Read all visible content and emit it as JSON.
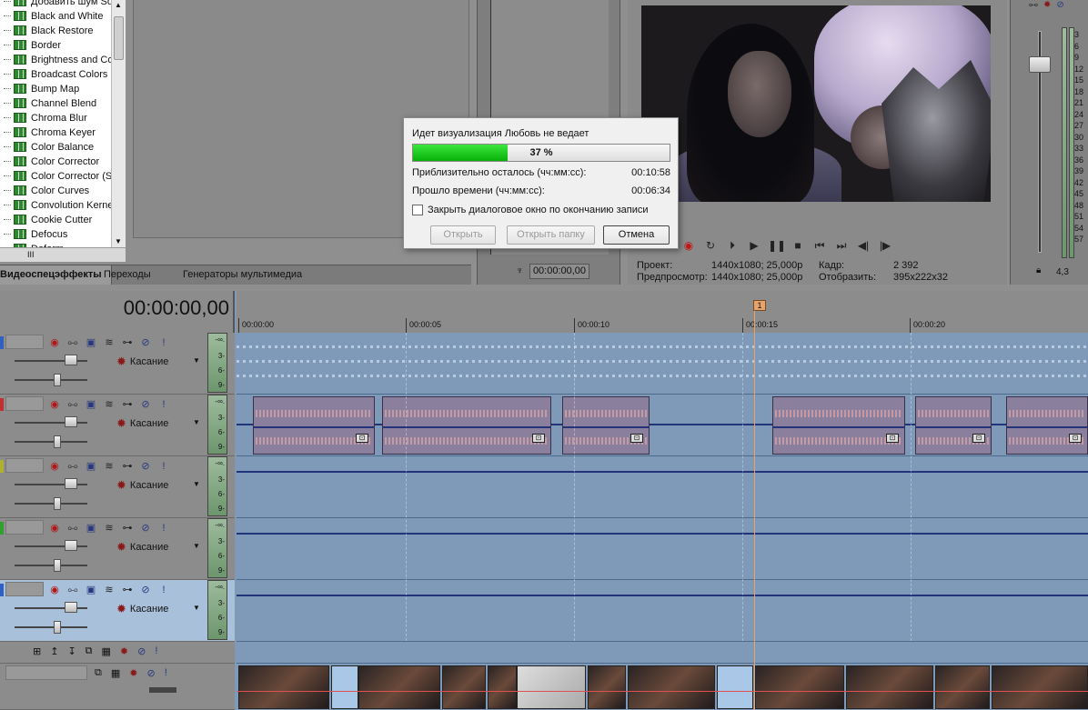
{
  "effects": {
    "items": [
      "Добавить шум Sony",
      "Black and White",
      "Black Restore",
      "Border",
      "Brightness and Co",
      "Broadcast Colors",
      "Bump Map",
      "Channel Blend",
      "Chroma Blur",
      "Chroma Keyer",
      "Color Balance",
      "Color Corrector",
      "Color Corrector (S",
      "Color Curves",
      "Convolution Kerne",
      "Cookie Cutter",
      "Defocus",
      "Deform"
    ],
    "hscroll_label": "III"
  },
  "tabs": {
    "effects": "Видеоспецэффекты",
    "transitions": "Переходы",
    "generators": "Генераторы мультимедиа"
  },
  "trimmer": {
    "time": "00:00:00,00"
  },
  "preview": {
    "project_label": "Проект:",
    "project_value": "1440x1080; 25,000p",
    "preview_label": "Предпросмотр:",
    "preview_value": "1440x1080; 25,000p",
    "frame_label": "Кадр:",
    "frame_value": "2 392",
    "display_label": "Отобразить:",
    "display_value": "395x222x32"
  },
  "master": {
    "scale": [
      "3",
      "6",
      "9",
      "12",
      "15",
      "18",
      "21",
      "24",
      "27",
      "30",
      "33",
      "36",
      "39",
      "42",
      "45",
      "48",
      "51",
      "54",
      "57"
    ],
    "value": "4,3"
  },
  "timeline": {
    "timecode": "00:00:00,00",
    "marker": "1",
    "ticks": [
      "00:00:00",
      "00:00:05",
      "00:00:10",
      "00:00:15",
      "00:00:20"
    ]
  },
  "tracks": [
    {
      "mode": "Касание",
      "color": "#3060c0"
    },
    {
      "mode": "Касание",
      "color": "#c03030"
    },
    {
      "mode": "Касание",
      "color": "#b0b030"
    },
    {
      "mode": "Касание",
      "color": "#30a030"
    },
    {
      "mode": "Касание",
      "color": "#3060c0"
    }
  ],
  "meter_labels": [
    "-∞.",
    "3-",
    "6-",
    "9-"
  ],
  "dialog": {
    "title": "Идет визуализация Любовь не ведает",
    "progress_text": "37 %",
    "progress": 0.37,
    "remaining_label": "Приблизительно осталось (чч:мм:сс):",
    "remaining_value": "00:10:58",
    "elapsed_label": "Прошло времени (чч:мм:сс):",
    "elapsed_value": "00:06:34",
    "close_checkbox": "Закрыть диалоговое окно по окончанию записи",
    "open_button": "Открыть",
    "open_folder_button": "Открыть папку",
    "cancel_button": "Отмена"
  }
}
